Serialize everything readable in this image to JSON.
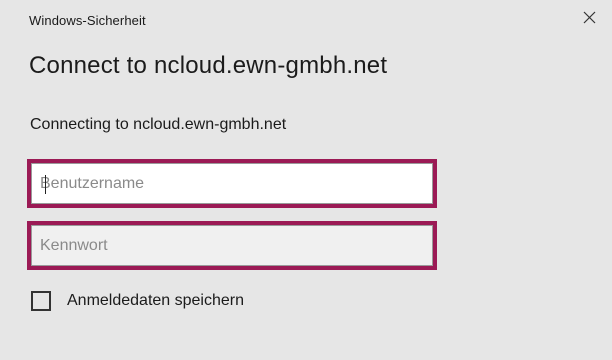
{
  "window": {
    "caption": "Windows-Sicherheit",
    "close_icon": "close-icon"
  },
  "dialog": {
    "title": "Connect to ncloud.ewn-gmbh.net",
    "message": "Connecting to ncloud.ewn-gmbh.net"
  },
  "form": {
    "username": {
      "placeholder": "Benutzername",
      "value": ""
    },
    "password": {
      "placeholder": "Kennwort",
      "value": ""
    },
    "remember": {
      "label": "Anmeldedaten speichern",
      "checked": false
    }
  },
  "colors": {
    "highlight_border": "#9b1a55",
    "dialog_background": "#e6e6e6"
  }
}
